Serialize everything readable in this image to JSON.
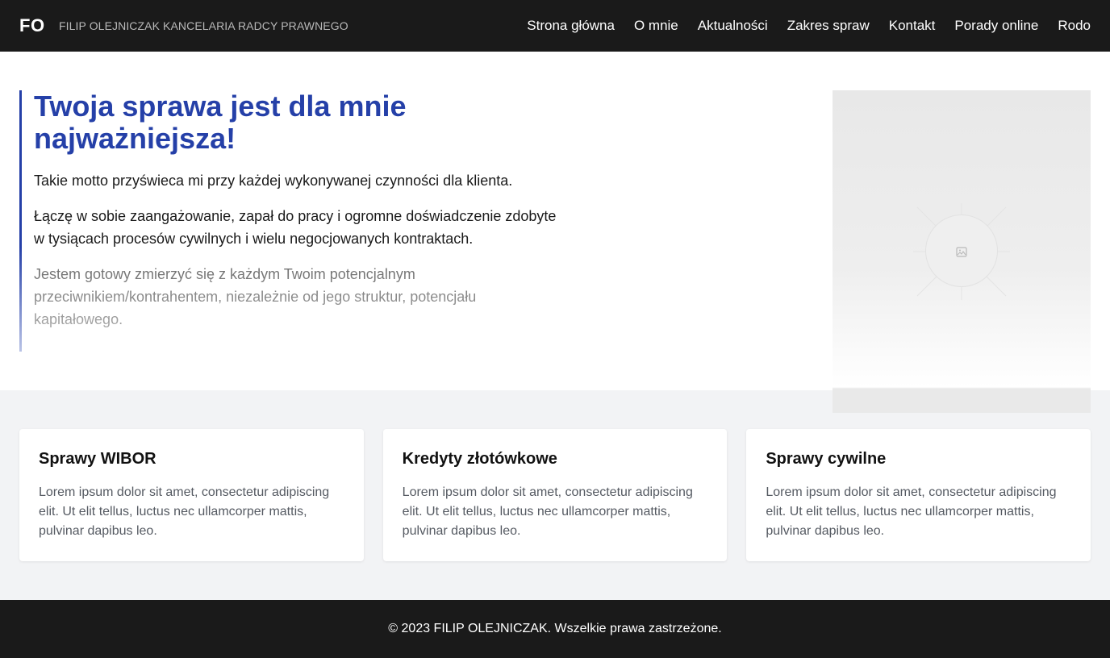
{
  "header": {
    "logo": "FO",
    "firm_name": "FILIP OLEJNICZAK KANCELARIA RADCY PRAWNEGO",
    "nav": [
      "Strona główna",
      "O mnie",
      "Aktualności",
      "Zakres spraw",
      "Kontakt",
      "Porady online",
      "Rodo"
    ]
  },
  "hero": {
    "title": "Twoja sprawa jest dla mnie najważniejsza!",
    "paragraphs": [
      "Takie motto przyświeca mi przy każdej wykonywanej czynności dla klienta.",
      "Łączę w sobie zaangażowanie, zapał do pracy i ogromne doświadczenie zdobyte w tysiącach procesów cywilnych i wielu negocjowanych kontraktach.",
      "Jestem gotowy zmierzyć się z każdym Twoim potencjalnym przeciwnikiem/kontrahentem, niezależnie od jego struktur, potencjału kapitałowego."
    ],
    "accent_color": "#2540a8",
    "image_icon": "image-placeholder-icon"
  },
  "cards": [
    {
      "title": "Sprawy WIBOR",
      "text": "Lorem ipsum dolor sit amet, consectetur adipiscing elit. Ut elit tellus, luctus nec ullamcorper mattis, pulvinar dapibus leo."
    },
    {
      "title": "Kredyty złotówkowe",
      "text": "Lorem ipsum dolor sit amet, consectetur adipiscing elit. Ut elit tellus, luctus nec ullamcorper mattis, pulvinar dapibus leo."
    },
    {
      "title": "Sprawy cywilne",
      "text": "Lorem ipsum dolor sit amet, consectetur adipiscing elit. Ut elit tellus, luctus nec ullamcorper mattis, pulvinar dapibus leo."
    }
  ],
  "footer": {
    "copyright": "© 2023 FILIP OLEJNICZAK. Wszelkie prawa zastrzeżone."
  }
}
